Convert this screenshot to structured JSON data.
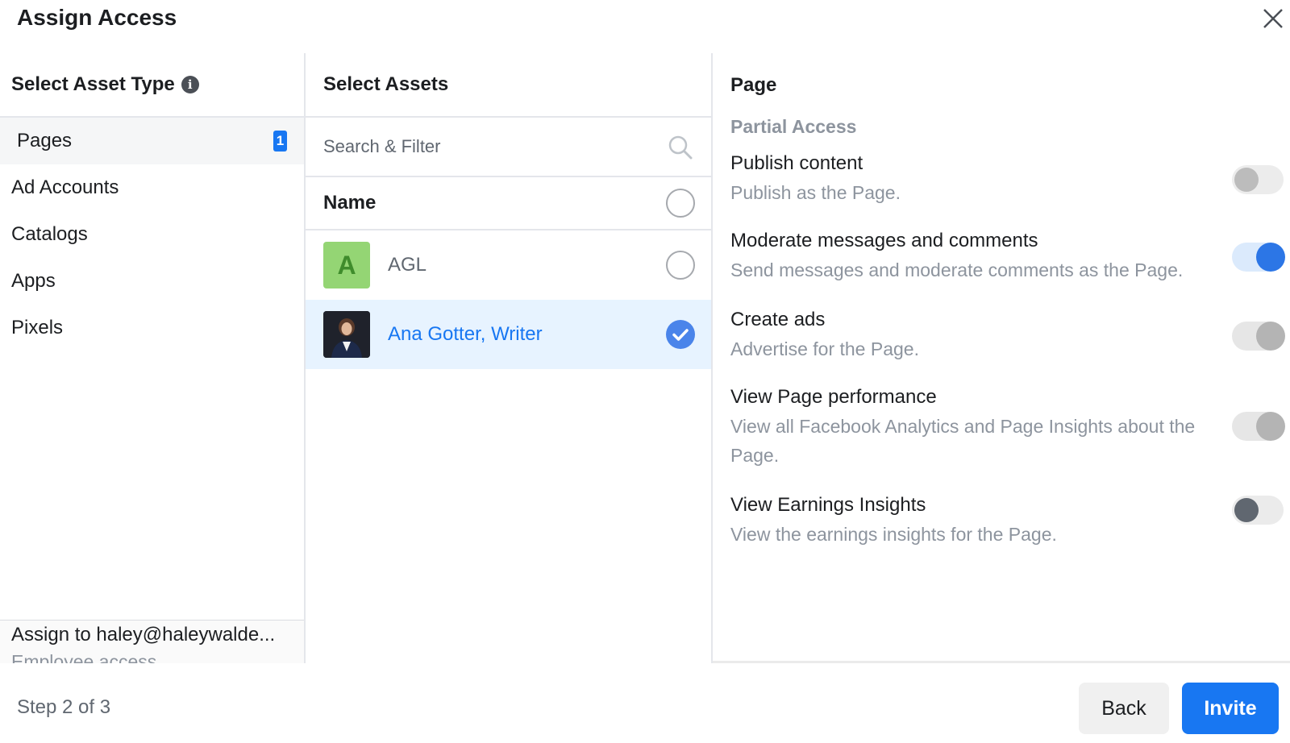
{
  "dialog": {
    "title": "Assign Access",
    "close_icon": "close-icon"
  },
  "asset_types": {
    "header": "Select Asset Type",
    "info_icon": "i",
    "items": [
      {
        "label": "Pages",
        "active": true,
        "badge": "1"
      },
      {
        "label": "Ad Accounts",
        "active": false
      },
      {
        "label": "Catalogs",
        "active": false
      },
      {
        "label": "Apps",
        "active": false
      },
      {
        "label": "Pixels",
        "active": false
      }
    ],
    "assign_to": "Assign to haley@haleywalde...",
    "access_type": "Employee access"
  },
  "assets": {
    "header": "Select Assets",
    "search_placeholder": "Search & Filter",
    "name_column": "Name",
    "rows": [
      {
        "avatar_letter": "A",
        "name": "AGL",
        "selected": false
      },
      {
        "name": "Ana Gotter, Writer",
        "selected": true
      }
    ]
  },
  "permissions": {
    "header": "Page",
    "section": "Partial Access",
    "items": [
      {
        "title": "Publish content",
        "desc": "Publish as the Page.",
        "state": "off"
      },
      {
        "title": "Moderate messages and comments",
        "desc": "Send messages and moderate comments as the Page.",
        "state": "on"
      },
      {
        "title": "Create ads",
        "desc": "Advertise for the Page.",
        "state": "on-disabled"
      },
      {
        "title": "View Page performance",
        "desc": "View all Facebook Analytics and Page Insights about the Page.",
        "state": "on-disabled"
      },
      {
        "title": "View Earnings Insights",
        "desc": "View the earnings insights for the Page.",
        "state": "off"
      }
    ]
  },
  "footer": {
    "step": "Step 2 of 3",
    "back_label": "Back",
    "invite_label": "Invite"
  },
  "colors": {
    "primary": "#1877f2",
    "selected_row": "#e7f3ff",
    "toggle_on": "#2c76e6"
  }
}
